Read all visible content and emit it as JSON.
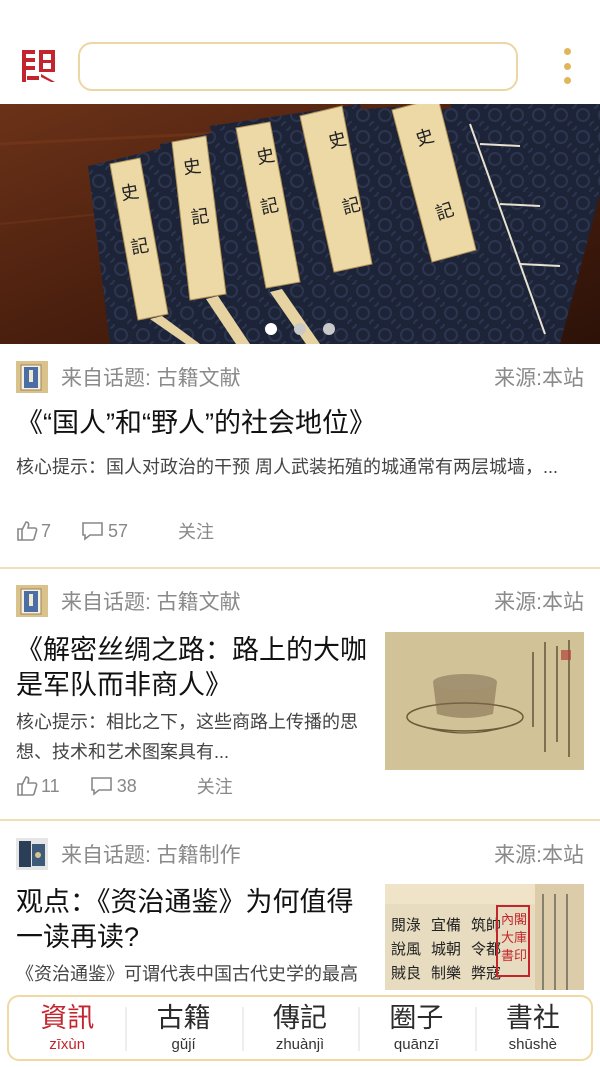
{
  "header": {
    "search_placeholder": ""
  },
  "banner": {
    "book_label": "史\n記",
    "slides": 3,
    "active_slide": 0
  },
  "feed": [
    {
      "topic": "来自话题: 古籍文献",
      "source": "来源:本站",
      "title": "《“国人”和“野人”的社会地位》",
      "summary": "核心提示：国人对政治的干预 周人武装拓殖的城通常有两层城墙，...",
      "likes": "7",
      "comments": "57",
      "follow": "关注"
    },
    {
      "topic": "来自话题: 古籍文献",
      "source": "来源:本站",
      "title": "《解密丝绸之路：路上的大咖是军队而非商人》",
      "summary": "核心提示：相比之下，这些商路上传播的思想、技术和艺术图案具有...",
      "likes": "11",
      "comments": "38",
      "follow": "关注"
    },
    {
      "topic": "来自话题: 古籍制作",
      "source": "来源:本站",
      "title": "观点：《资治通鉴》为何值得一读再读?",
      "summary": "《资治通鉴》可谓代表中国古代史学的最高"
    }
  ],
  "bottom_nav": [
    {
      "label": "資訊",
      "pinyin": "zīxùn",
      "active": true
    },
    {
      "label": "古籍",
      "pinyin": "gǔjí",
      "active": false
    },
    {
      "label": "傳記",
      "pinyin": "zhuànjì",
      "active": false
    },
    {
      "label": "圈子",
      "pinyin": "quānzī",
      "active": false
    },
    {
      "label": "書社",
      "pinyin": "shūshè",
      "active": false
    }
  ],
  "colors": {
    "accent_red": "#c3252e",
    "gold": "#e0b65b",
    "divider_gold": "#f0dfb6"
  }
}
